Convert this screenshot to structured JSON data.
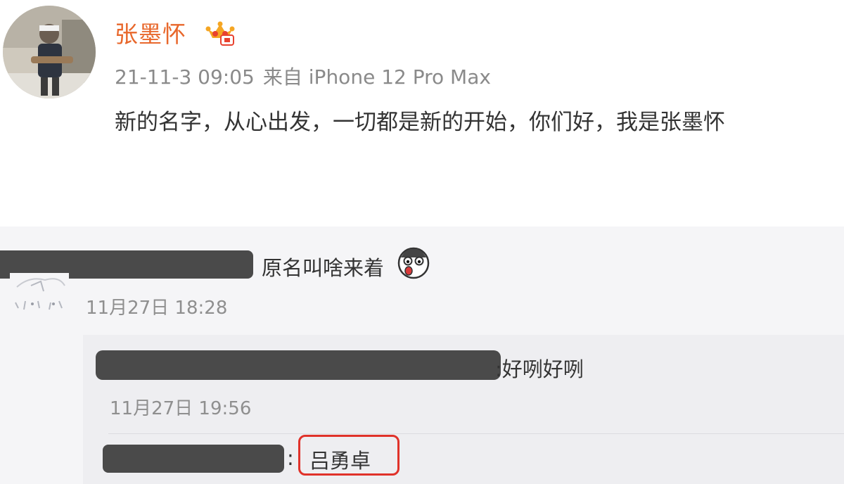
{
  "post": {
    "author_name": "张墨怀",
    "timestamp": "21-11-3 09:05",
    "source": "来自 iPhone 12 Pro Max",
    "text": "新的名字，从心出发，一切都是新的开始，你们好，我是张墨怀",
    "avatar_icon": "avatar",
    "badge_icon": "vip-crown-badge-icon"
  },
  "comments": {
    "first": {
      "text": "原名叫啥来着",
      "emoji_icon": "shocked-face-emoji-icon",
      "time": "11月27日 18:28"
    },
    "reply": {
      "text": ":好咧好咧",
      "time": "11月27日 19:56"
    },
    "second_reply": {
      "colon": ":",
      "text": "吕勇卓"
    }
  },
  "colors": {
    "author_name": "#e8672b",
    "highlight_border": "#e0322a",
    "redaction": "#4a4a4a",
    "comment_background": "#f5f5f7"
  }
}
